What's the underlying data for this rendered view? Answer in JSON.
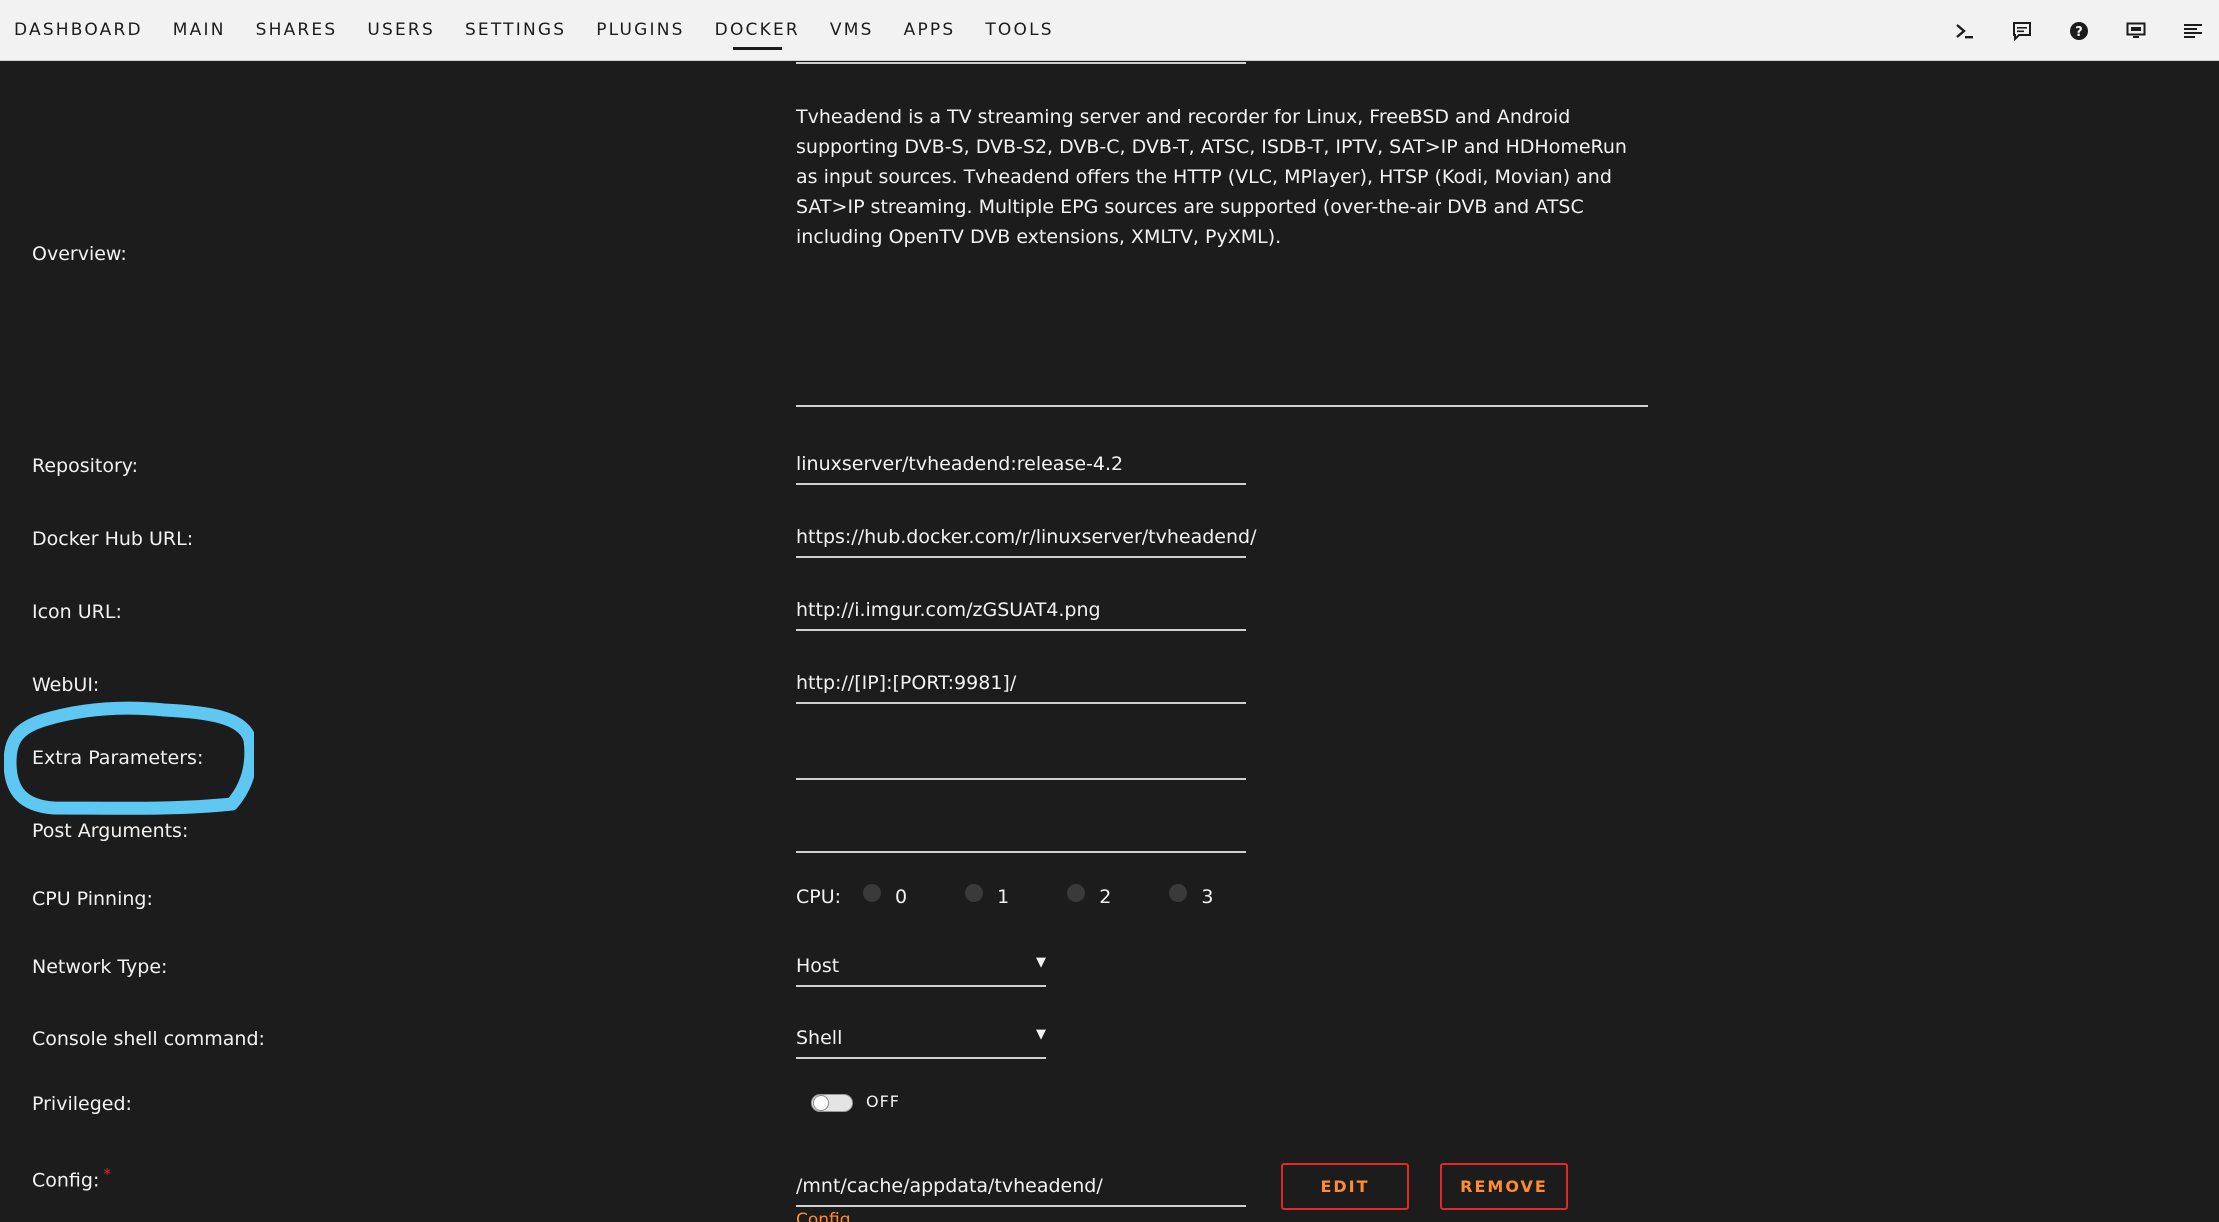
{
  "nav": {
    "items": [
      "DASHBOARD",
      "MAIN",
      "SHARES",
      "USERS",
      "SETTINGS",
      "PLUGINS",
      "DOCKER",
      "VMS",
      "APPS",
      "TOOLS"
    ],
    "active": "DOCKER"
  },
  "toolbar_icons": [
    "terminal-icon",
    "feedback-icon",
    "help-icon",
    "monitor-icon",
    "log-icon"
  ],
  "form": {
    "overview_label": "Overview:",
    "overview_text": "Tvheadend is a TV streaming server and recorder for Linux, FreeBSD and Android supporting DVB-S, DVB-S2, DVB-C, DVB-T, ATSC, ISDB-T, IPTV, SAT>IP and HDHomeRun as input sources. Tvheadend offers the HTTP (VLC, MPlayer), HTSP (Kodi, Movian) and SAT>IP streaming. Multiple EPG sources are supported (over-the-air DVB and ATSC including OpenTV DVB extensions, XMLTV, PyXML).",
    "repository_label": "Repository:",
    "repository_value": "linuxserver/tvheadend:release-4.2",
    "dockerhub_label": "Docker Hub URL:",
    "dockerhub_value": "https://hub.docker.com/r/linuxserver/tvheadend/",
    "icon_url_label": "Icon URL:",
    "icon_url_value": "http://i.imgur.com/zGSUAT4.png",
    "webui_label": "WebUI:",
    "webui_value": "http://[IP]:[PORT:9981]/",
    "extra_params_label": "Extra Parameters:",
    "extra_params_value": "",
    "post_args_label": "Post Arguments:",
    "post_args_value": "",
    "cpu_pinning_label": "CPU Pinning:",
    "cpu_prefix": "CPU:",
    "cpu_cores": [
      "0",
      "1",
      "2",
      "3"
    ],
    "network_type_label": "Network Type:",
    "network_type_value": "Host",
    "console_label": "Console shell command:",
    "console_value": "Shell",
    "privileged_label": "Privileged:",
    "privileged_state": "OFF",
    "config_label": "Config:",
    "config_required_mark": "*",
    "config_value": "/mnt/cache/appdata/tvheadend/",
    "config_sub_label": "Config",
    "edit_label": "EDIT",
    "remove_label": "REMOVE"
  },
  "colors": {
    "background": "#1c1c1c",
    "topbar": "#f2f2f2",
    "accent": "#ff8c2f",
    "button_border": "#e22828",
    "annotation": "#5ec8f2"
  }
}
